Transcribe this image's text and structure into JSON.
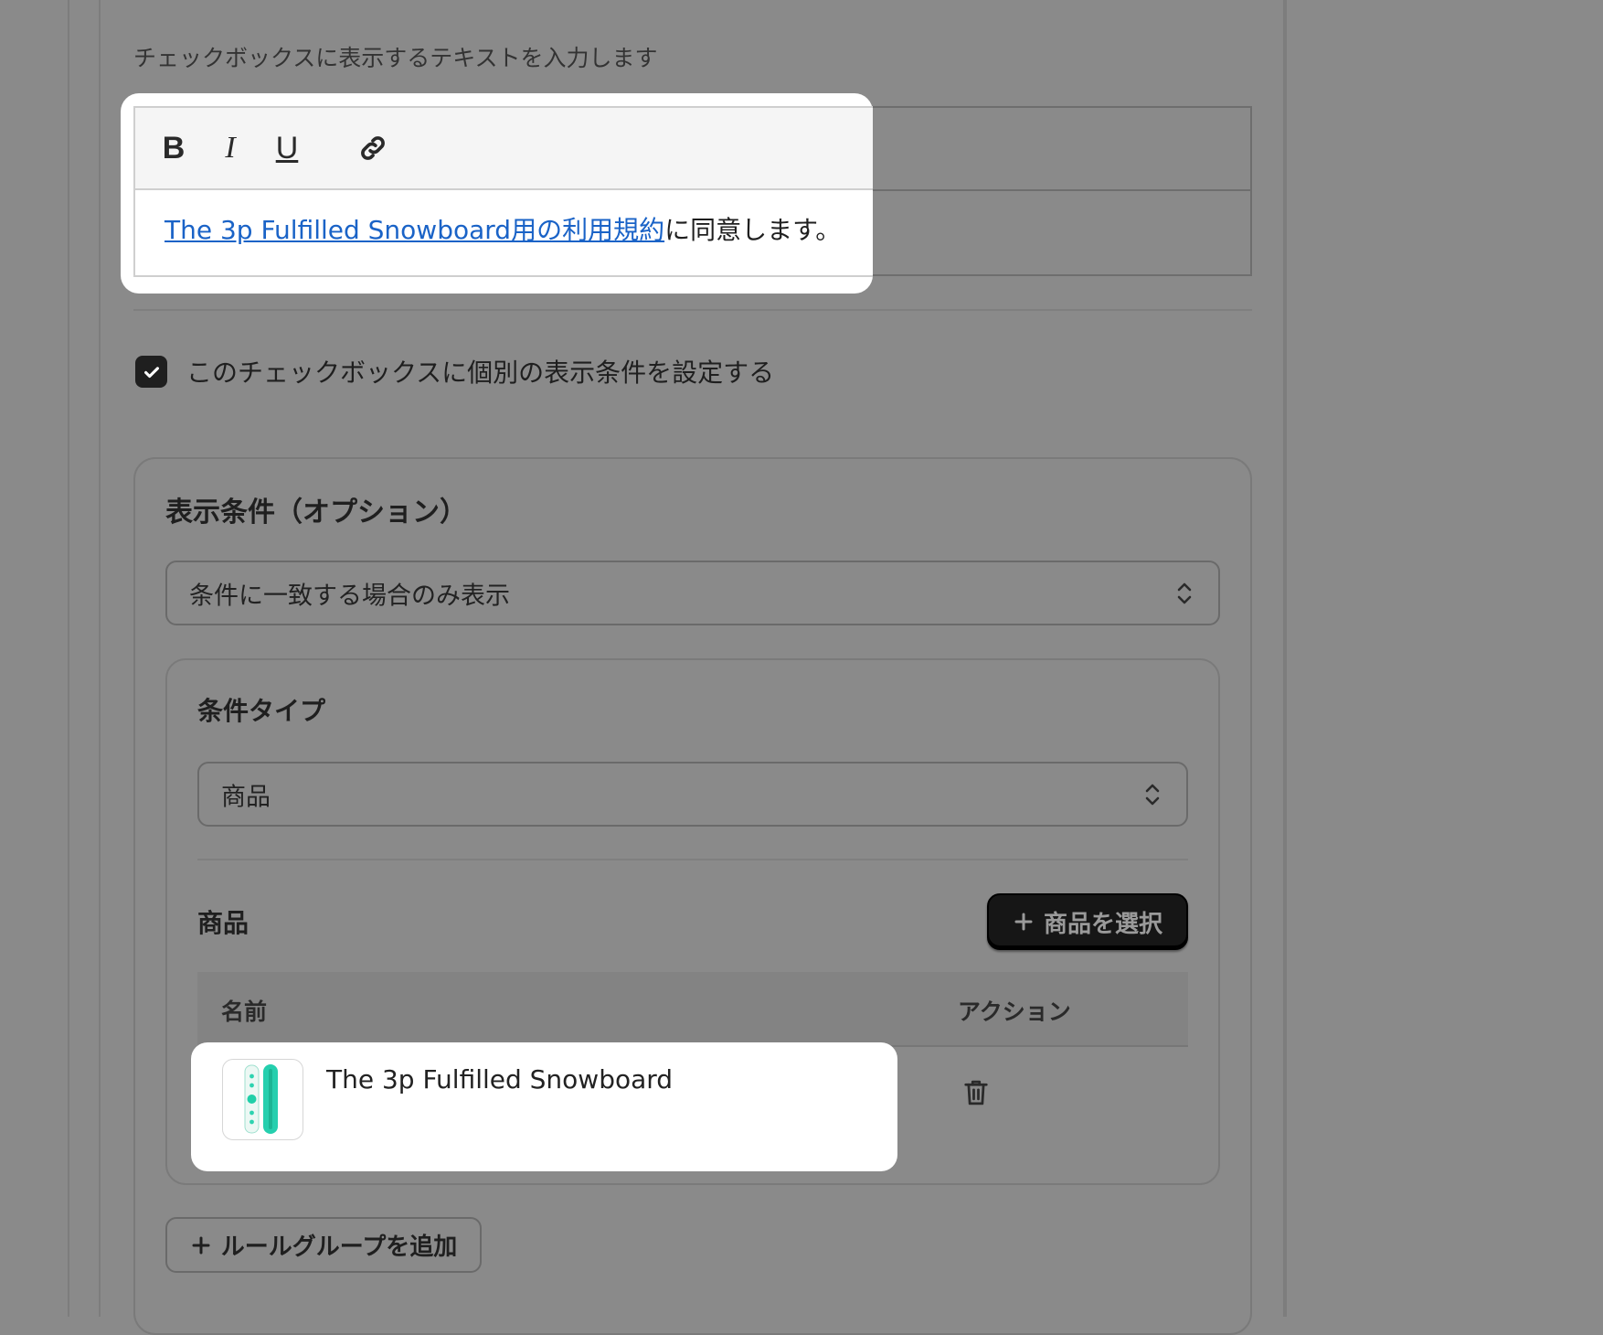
{
  "editor": {
    "helper_text": "チェックボックスに表示するテキストを入力します",
    "toolbar": {
      "bold_label": "B",
      "italic_label": "I",
      "underline_label": "U"
    },
    "link_text": "The 3p Fulfilled Snowboard用の利用規約",
    "trailing_text": "に同意します。"
  },
  "visibility_checkbox": {
    "checked": true,
    "label": "このチェックボックスに個別の表示条件を設定する"
  },
  "conditions": {
    "title": "表示条件（オプション）",
    "mode_select": {
      "value": "条件に一致する場合のみ表示"
    },
    "rule_group": {
      "type_title": "条件タイプ",
      "type_select": {
        "value": "商品"
      },
      "products_title": "商品",
      "select_button_label": "商品を選択",
      "table": {
        "columns": [
          "名前",
          "アクション"
        ],
        "rows": [
          {
            "name": "The 3p Fulfilled Snowboard"
          }
        ]
      }
    },
    "add_group_label": "ルールグループを追加"
  },
  "colors": {
    "overlay": "#8a8a8a",
    "link": "#1a63c7",
    "primary_button": "#161616"
  },
  "icons": [
    "link-icon",
    "check-icon",
    "chevron-updown-icon",
    "plus-icon",
    "trash-icon",
    "product-thumbnail"
  ]
}
